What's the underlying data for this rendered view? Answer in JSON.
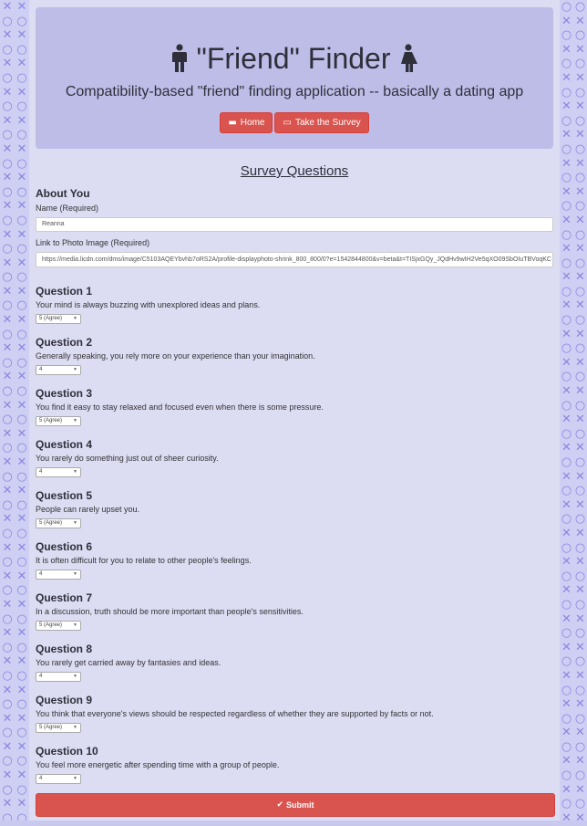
{
  "header": {
    "title": "\"Friend\" Finder",
    "subtitle": "Compatibility-based \"friend\" finding application -- basically a dating app",
    "home_label": "Home",
    "survey_label": "Take the Survey"
  },
  "survey": {
    "title": "Survey Questions",
    "about_heading": "About You",
    "name_label": "Name (Required)",
    "name_value": "Reanna",
    "photo_label": "Link to Photo Image (Required)",
    "photo_value": "https://media.licdn.com/dms/image/C5103AQEYbvhb7oRS2A/profile-displayphoto-shrink_800_800/0?e=1542844800&v=beta&t=TISjxGQy_JQdHv9wIH2Ve5qXO09SbOIuTBVoqKC",
    "questions": [
      {
        "title": "Question 1",
        "text": "Your mind is always buzzing with unexplored ideas and plans.",
        "answer": "5 (Agree)"
      },
      {
        "title": "Question 2",
        "text": "Generally speaking, you rely more on your experience than your imagination.",
        "answer": "4"
      },
      {
        "title": "Question 3",
        "text": "You find it easy to stay relaxed and focused even when there is some pressure.",
        "answer": "5 (Agree)"
      },
      {
        "title": "Question 4",
        "text": "You rarely do something just out of sheer curiosity.",
        "answer": "4"
      },
      {
        "title": "Question 5",
        "text": "People can rarely upset you.",
        "answer": "5 (Agree)"
      },
      {
        "title": "Question 6",
        "text": "It is often difficult for you to relate to other people's feelings.",
        "answer": "4"
      },
      {
        "title": "Question 7",
        "text": "In a discussion, truth should be more important than people's sensitivities.",
        "answer": "5 (Agree)"
      },
      {
        "title": "Question 8",
        "text": "You rarely get carried away by fantasies and ideas.",
        "answer": "4"
      },
      {
        "title": "Question 9",
        "text": "You think that everyone's views should be respected regardless of whether they are supported by facts or not.",
        "answer": "5 (Agree)"
      },
      {
        "title": "Question 10",
        "text": "You feel more energetic after spending time with a group of people.",
        "answer": "4"
      }
    ],
    "submit_label": "Submit"
  },
  "icons": {
    "man": "man-icon",
    "woman": "woman-icon",
    "home": "card-icon",
    "survey": "credit-card-icon",
    "submit": "check-circle-icon"
  },
  "colors": {
    "button_red": "#d9534f",
    "jumbotron": "#bdbde8",
    "pattern": "#8b86e0"
  }
}
